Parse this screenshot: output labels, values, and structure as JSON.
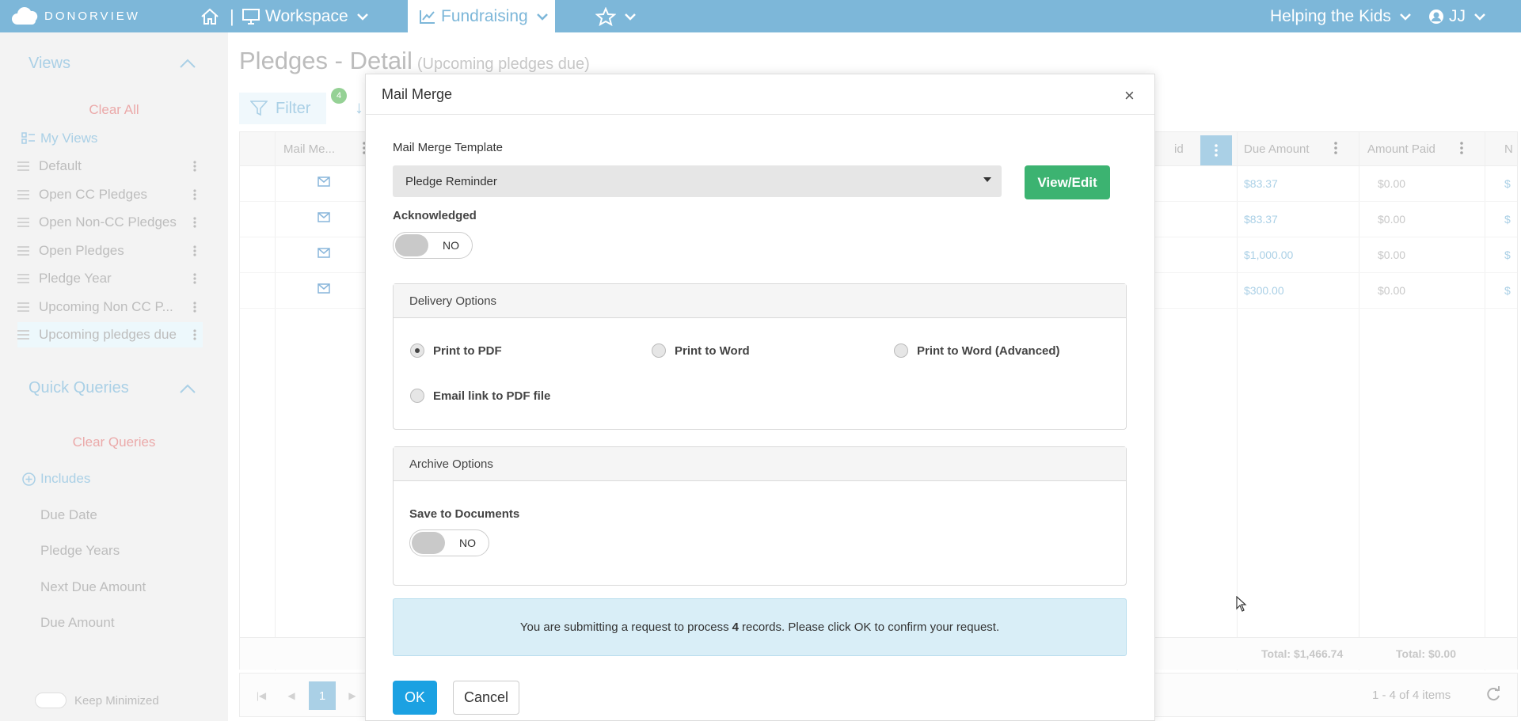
{
  "app": {
    "logo_text": "DONORVIEW",
    "nav": {
      "separator": "|",
      "workspace": "Workspace",
      "fundraising": "Fundraising",
      "org": "Helping the Kids",
      "user": "JJ"
    }
  },
  "sidebar": {
    "views_title": "Views",
    "clear_all": "Clear All",
    "my_views": "My Views",
    "views": [
      "Default",
      "Open CC Pledges",
      "Open Non-CC Pledges",
      "Open Pledges",
      "Pledge Year",
      "Upcoming Non CC P...",
      "Upcoming pledges due"
    ],
    "quick_queries_title": "Quick Queries",
    "clear_queries": "Clear Queries",
    "includes": "Includes",
    "queries": [
      "Due Date",
      "Pledge Years",
      "Next Due Amount",
      "Due Amount"
    ],
    "keep_minimized": "Keep Minimized"
  },
  "page": {
    "title": "Pledges - Detail",
    "subtitle": "(Upcoming pledges due)",
    "filter_label": "Filter",
    "filter_count": "4"
  },
  "grid": {
    "columns": {
      "mail": "Mail Me...",
      "paid_partial": "id",
      "due_amount": "Due Amount",
      "amount_paid": "Amount Paid",
      "next_partial": "N"
    },
    "rows": [
      {
        "due": "$83.37",
        "paid": "$0.00",
        "next": "$"
      },
      {
        "due": "$83.37",
        "paid": "$0.00",
        "next": "$"
      },
      {
        "due": "$1,000.00",
        "paid": "$0.00",
        "next": "$"
      },
      {
        "due": "$300.00",
        "paid": "$0.00",
        "next": "$"
      }
    ],
    "total_due": "Total: $1,466.74",
    "total_paid": "Total: $0.00",
    "page": "1",
    "range": "1 - 4 of 4 items"
  },
  "modal": {
    "title": "Mail Merge",
    "close": "×",
    "template_label": "Mail Merge Template",
    "template_value": "Pledge Reminder",
    "view_edit": "View/Edit",
    "acknowledged_label": "Acknowledged",
    "acknowledged_value": "NO",
    "delivery_title": "Delivery Options",
    "delivery": [
      "Print to PDF",
      "Print to Word",
      "Print to Word (Advanced)",
      "Email link to PDF file"
    ],
    "delivery_selected": "Print to PDF",
    "archive_title": "Archive Options",
    "save_docs_label": "Save to Documents",
    "save_docs_value": "NO",
    "info_pre": "You are submitting a request to process",
    "info_count": "4",
    "info_post": "records. Please click OK to confirm your request.",
    "ok": "OK",
    "cancel": "Cancel"
  },
  "colors": {
    "brand": "#7db7d9",
    "success": "#3cb371",
    "primary": "#1ba1e2",
    "danger_text": "#e07b7b",
    "info_bg": "#d9eef7"
  }
}
